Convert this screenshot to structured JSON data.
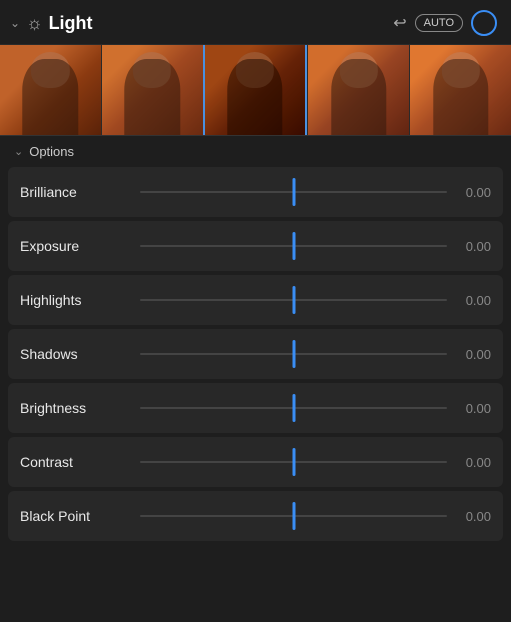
{
  "header": {
    "title": "Light",
    "auto_label": "AUTO",
    "undo_symbol": "↩",
    "chevron_symbol": "⌄"
  },
  "options": {
    "label": "Options",
    "chevron_symbol": "⌄"
  },
  "sliders": [
    {
      "id": "brilliance",
      "label": "Brilliance",
      "value": "0.00"
    },
    {
      "id": "exposure",
      "label": "Exposure",
      "value": "0.00"
    },
    {
      "id": "highlights",
      "label": "Highlights",
      "value": "0.00"
    },
    {
      "id": "shadows",
      "label": "Shadows",
      "value": "0.00"
    },
    {
      "id": "brightness",
      "label": "Brightness",
      "value": "0.00"
    },
    {
      "id": "contrast",
      "label": "Contrast",
      "value": "0.00"
    },
    {
      "id": "black-point",
      "label": "Black Point",
      "value": "0.00"
    }
  ],
  "filmstrip": {
    "count": 5
  }
}
